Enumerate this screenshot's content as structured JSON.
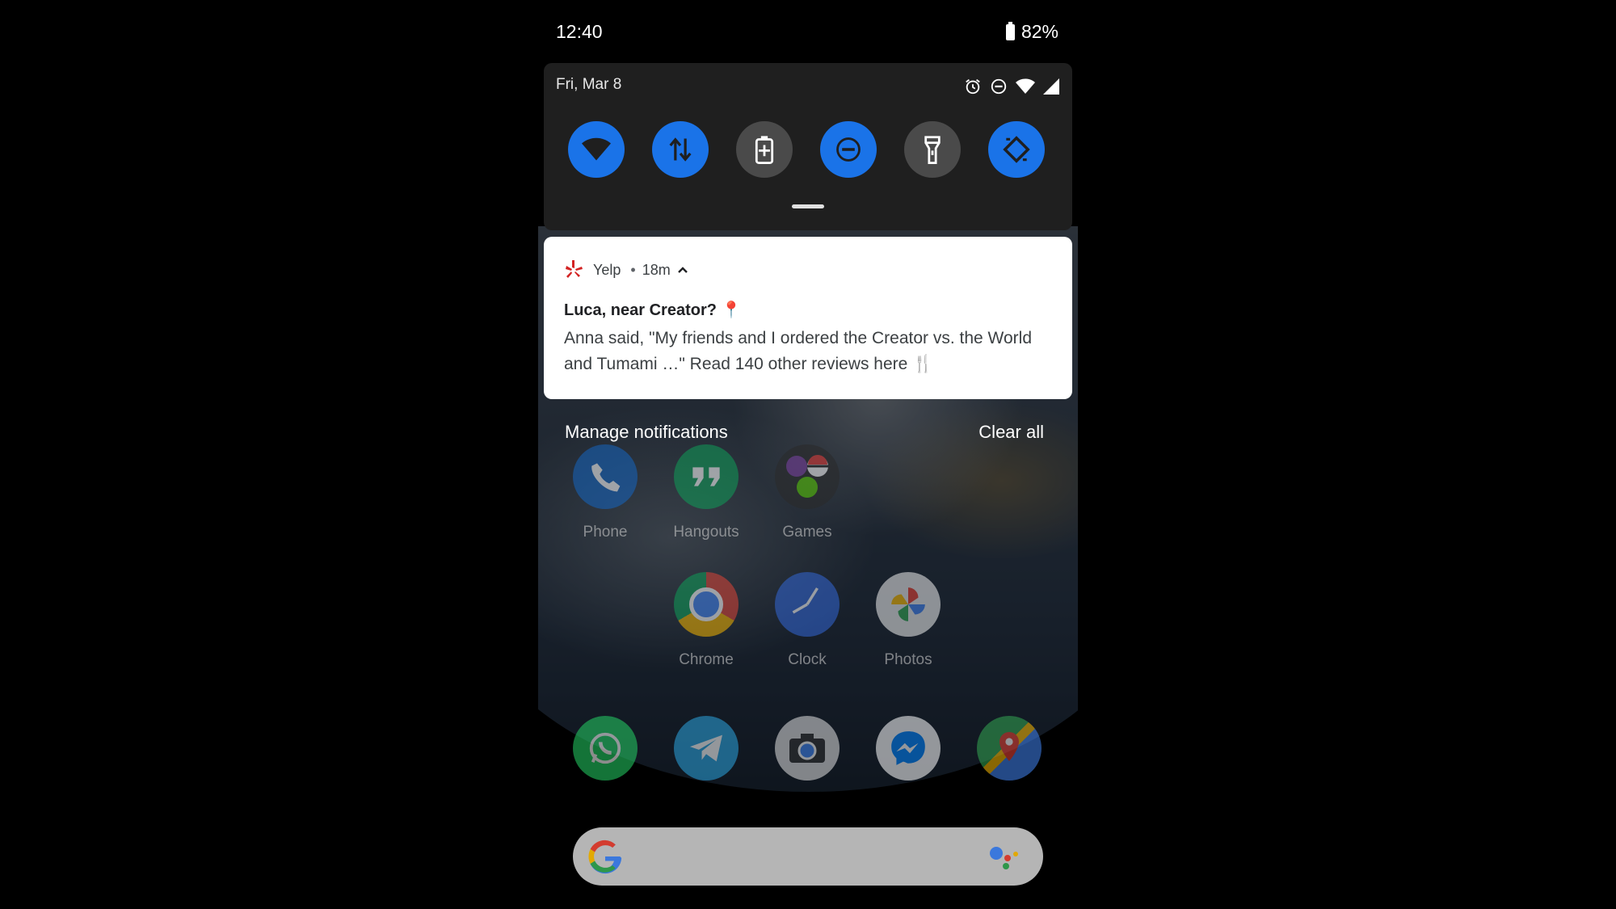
{
  "status_bar": {
    "time": "12:40",
    "battery": "82%"
  },
  "quick_settings": {
    "date": "Fri, Mar 8",
    "tiles": [
      {
        "name": "wifi",
        "state": "on"
      },
      {
        "name": "mobile-data",
        "state": "on"
      },
      {
        "name": "battery-saver",
        "state": "off"
      },
      {
        "name": "do-not-disturb",
        "state": "on"
      },
      {
        "name": "flashlight",
        "state": "off"
      },
      {
        "name": "auto-rotate",
        "state": "on"
      }
    ]
  },
  "notification": {
    "app": "Yelp",
    "separator": "•",
    "age": "18m",
    "title": "Luca, near Creator? 📍",
    "body": "Anna said, \"My friends and I ordered the Creator vs. the World and Tumami …\" Read 140 other reviews here 🍴"
  },
  "shade_actions": {
    "manage": "Manage notifications",
    "clear": "Clear all"
  },
  "home": {
    "row1": [
      "Phone",
      "Hangouts",
      "Games"
    ],
    "row2": [
      "Chrome",
      "Clock",
      "Photos"
    ],
    "dock": [
      "WhatsApp",
      "Telegram",
      "Camera",
      "Messenger",
      "Maps"
    ]
  },
  "colors": {
    "accent": "#1a73e8",
    "tile_off": "#4a4a4a",
    "yelp_red": "#d32323"
  }
}
